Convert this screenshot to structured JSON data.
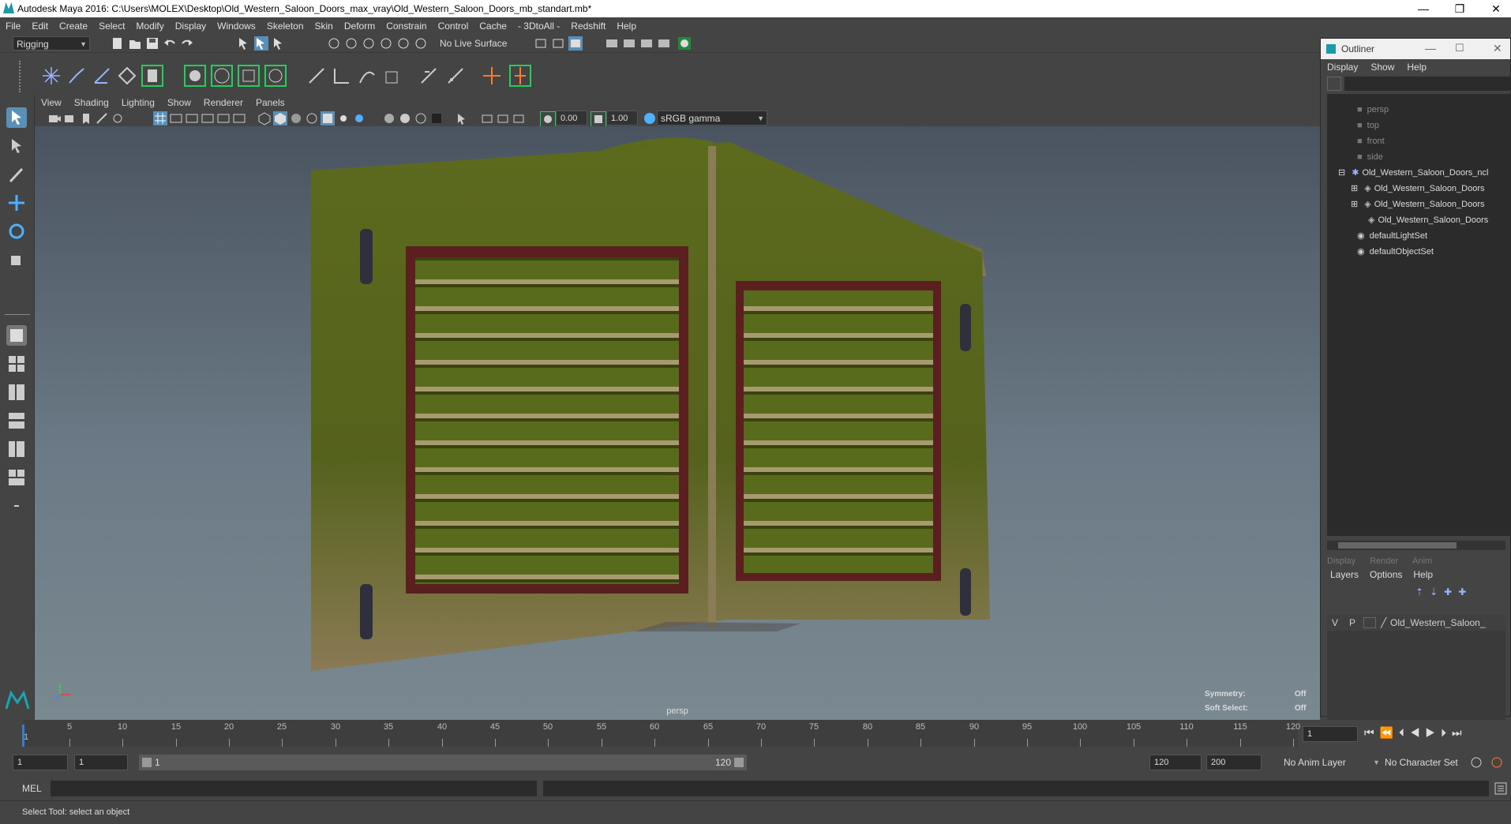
{
  "window": {
    "title": "Autodesk Maya 2016: C:\\Users\\MOLEX\\Desktop\\Old_Western_Saloon_Doors_max_vray\\Old_Western_Saloon_Doors_mb_standart.mb*",
    "minimize_glyph": "—",
    "restore_glyph": "❐",
    "close_glyph": "✕"
  },
  "menubar": [
    "File",
    "Edit",
    "Create",
    "Select",
    "Modify",
    "Display",
    "Windows",
    "Skeleton",
    "Skin",
    "Deform",
    "Constrain",
    "Control",
    "Cache",
    "- 3DtoAll -",
    "Redshift",
    "Help"
  ],
  "statusline": {
    "menuset": "Rigging",
    "live_surface": "No Live Surface"
  },
  "viewport": {
    "menu": [
      "View",
      "Shading",
      "Lighting",
      "Show",
      "Renderer",
      "Panels"
    ],
    "exposure": "0.00",
    "gamma": "1.00",
    "color_space": "sRGB gamma",
    "camera_label": "persp",
    "hud": {
      "symmetry_label": "Symmetry:",
      "symmetry_value": "Off",
      "soft_select_label": "Soft Select:",
      "soft_select_value": "Off"
    }
  },
  "outliner": {
    "title": "Outliner",
    "menu": [
      "Display",
      "Show",
      "Help"
    ],
    "items": [
      {
        "label": "persp",
        "kind": "camera"
      },
      {
        "label": "top",
        "kind": "camera"
      },
      {
        "label": "front",
        "kind": "camera"
      },
      {
        "label": "side",
        "kind": "camera"
      },
      {
        "label": "Old_Western_Saloon_Doors_ncl",
        "kind": "group"
      },
      {
        "label": "Old_Western_Saloon_Doors",
        "kind": "mesh"
      },
      {
        "label": "Old_Western_Saloon_Doors",
        "kind": "mesh"
      },
      {
        "label": "Old_Western_Saloon_Doors",
        "kind": "mesh"
      },
      {
        "label": "defaultLightSet",
        "kind": "set"
      },
      {
        "label": "defaultObjectSet",
        "kind": "set"
      }
    ],
    "layer_tabs": [
      "Display",
      "Render",
      "Anim"
    ],
    "layer_menu": [
      "Layers",
      "Options",
      "Help"
    ],
    "layer_row": {
      "v": "V",
      "p": "P",
      "name": "Old_Western_Saloon_"
    }
  },
  "timeline": {
    "ticks": [
      5,
      10,
      15,
      20,
      25,
      30,
      35,
      40,
      45,
      50,
      55,
      60,
      65,
      70,
      75,
      80,
      85,
      90,
      95,
      100,
      105,
      110,
      115,
      120
    ],
    "start_label": "1",
    "current_frame": "1"
  },
  "range": {
    "start": "1",
    "playback_start": "1",
    "slider_start": "1",
    "slider_end": "120",
    "playback_end": "120",
    "end": "200",
    "anim_layer": "No Anim Layer",
    "character_set": "No Character Set"
  },
  "command": {
    "mel_label": "MEL",
    "help_text": "Select Tool: select an object"
  }
}
